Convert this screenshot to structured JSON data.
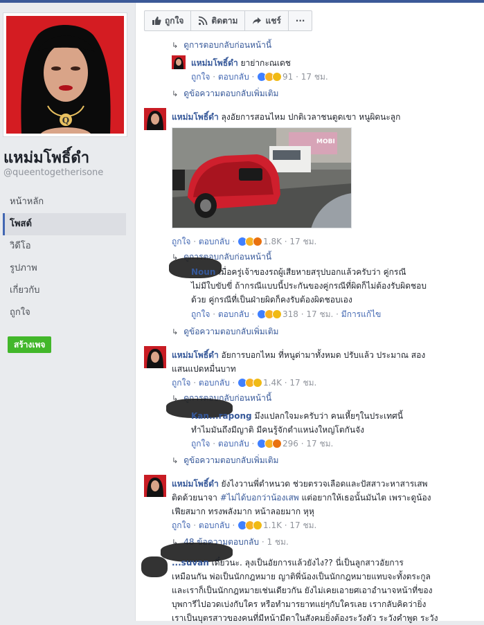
{
  "page": {
    "name": "แหม่มโพธิ์ดำ",
    "handle": "@queentogetherisone",
    "nav": [
      "หน้าหลัก",
      "โพสต์",
      "วิดีโอ",
      "รูปภาพ",
      "เกี่ยวกับ",
      "ถูกใจ"
    ],
    "create_page": "สร้างเพจ"
  },
  "actions": {
    "like": "ถูกใจ",
    "follow": "ติดตาม",
    "share": "แชร์",
    "more": "···"
  },
  "labels": {
    "like": "ถูกใจ",
    "reply": "ตอบกลับ",
    "edited": "มีการแก้ไข"
  },
  "feed": {
    "prev_replies_top": "ดูการตอบกลับก่อนหน้านี้",
    "reply1": {
      "name": "แหม่มโพธิ์ดำ",
      "text": "ยาย่ากะณเดช",
      "count": "91",
      "time": "17 ชม."
    },
    "more_replies_1": "ดูข้อความตอบกลับเพิ่มเติม",
    "comment1": {
      "name": "แหม่มโพธิ์ดำ",
      "text": "ลุงอัยการสอนไหม ปกติเวลาชนตูดเขา หนูผิดนะลูก",
      "count": "1.8K",
      "time": "17 ชม.",
      "photo_sign": "MOBI"
    },
    "prev_replies_1": "ดูการตอบกลับก่อนหน้านี้",
    "reply2": {
      "name": "Noun",
      "line1": "เมื่อครู่เจ้าของรถผู้เสียหายสรุปบอกแล้วครับว่า คู่กรณี",
      "line2": "ไม่มีใบขับขี่ ถ้ากรณีแบบนี้ประกันของคู่กรณีที่ผิดก็ไม่ต้องรับผิดชอบ",
      "line3": "ด้วย คู่กรณีที่เป็นฝ่ายผิดก็คงรับต้องผิดชอบเอง",
      "count": "318",
      "time": "17 ชม."
    },
    "more_replies_2": "ดูข้อความตอบกลับเพิ่มเติม",
    "comment2": {
      "name": "แหม่มโพธิ์ดำ",
      "line1": "อัยการบอกไหม ที่หนูด่ามาทั้งหมด ปรับแล้ว ประมาณ สอง",
      "line2": "แสนแปดหมื่นบาท",
      "count": "1.4K",
      "time": "17 ชม."
    },
    "prev_replies_2": "ดูการตอบกลับก่อนหน้านี้",
    "reply3": {
      "name": "Kan...rapong",
      "line1": "มึงแปลกใจมะครับว่า คนเหี้ยๆในประเทศนี้",
      "line2": "ทำไมมันถึงมีญาติ มีคนรู้จักตำแหน่งใหญ่โตกันจัง",
      "count": "296",
      "time": "17 ชม."
    },
    "more_replies_3": "ดูข้อความตอบกลับเพิ่มเติม",
    "comment3": {
      "name": "แหม่มโพธิ์ดำ",
      "line1": "ยังไงวานพี่ตำหนวด ช่วยตรวจเลือดและปัสสาวะหาสารเสพ",
      "line2_pre": "ติดด้วยนาจา ",
      "hashtag": "#ไม่ได้บอกว่าน้องเสพ",
      "line2_post": " แต่อยากให้เธอนั้นมันไต เพราะดูน้อง",
      "line3": "เฟียสมาก ทรงพลังมาก หน้าลอยมาก หุหุ",
      "count": "1.1K",
      "time": "17 ชม."
    },
    "replies_count": "48 ข้อความตอบกลับ",
    "replies_time": "· 1 ชม.",
    "comment4": {
      "name": "...suvan",
      "line1": "เดี๋ยวนะ. ลุงเป็นอัยการแล้วยังไง?? นี่เป็นลูกสาวอัยการ",
      "line2": "เหมือนกัน พ่อเป็นนักกฎหมาย ญาติพี่น้องเป็นนักกฎหมายแทบจะทั้งตระกูล",
      "line3": "และเราก็เป็นนักกฎหมายเช่นเดียวกัน ยังไม่เคยเอายศเอาอำนาจหน้าที่ของ",
      "line4": "บุพการีไปอวดเบ่งกับใคร หรือทำมารยาทแย่ๆกับใครเลย เรากลับคิดว่ายิ่ง",
      "line5": "เราเป็นบุตรสาวของคนที่มีหน้ามีตาในสังคมยิ่งต้องระวังตัว ระวังคำพูด ระวัง"
    }
  },
  "colors": {
    "facebook_blue": "#3b5998",
    "link": "#365899",
    "create_green": "#42b72a"
  }
}
